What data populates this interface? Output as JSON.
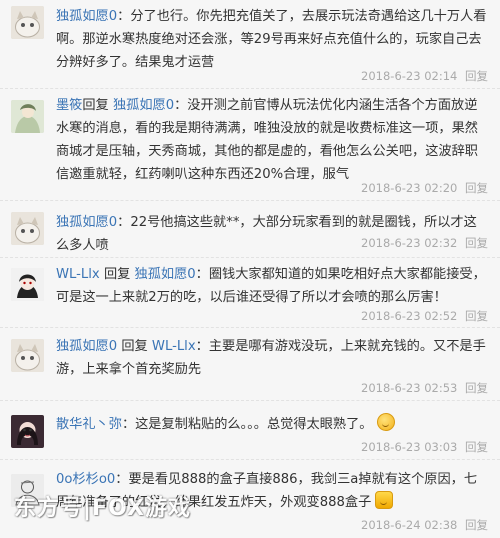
{
  "comments": [
    {
      "user": "独孤如愿0",
      "text": "：分了也行。你先把充值关了，去展示玩法奇遇给这几十万人看啊。那逆水寒热度绝对还会涨，等29号再来好点充值什么的，玩家自己去分辨好多了。结果鬼才运营",
      "time": "2018-6-23 02:14",
      "reply": "回复",
      "avatar_icon": "cat-avatar-icon"
    },
    {
      "user": "墨筱",
      "reply_word": "回复",
      "target": "独孤如愿0",
      "text": "：没开测之前官博从玩法优化内涵生活各个方面放逆水寒的消息，看的我是期待满满，唯独没放的就是收费标准这一项，果然商城才是压轴，天秀商城，其他的都是虚的，看他怎么公关吧，这波辞职信邀重就轻，红药喇叭这种东西还20%合理，服气",
      "time": "2018-6-23 02:20",
      "reply": "回复",
      "avatar_icon": "illustrated-avatar-icon"
    },
    {
      "user": "独孤如愿0",
      "text": "：22号他搞这些就**，大部分玩家看到的就是圈钱，所以才这么多人喷",
      "time": "2018-6-23 02:32",
      "reply": "回复",
      "avatar_icon": "cat-avatar-icon"
    },
    {
      "user": "WL-Llx",
      "reply_word": "回复",
      "target": "独孤如愿0",
      "text": "：圈钱大家都知道的如果吃相好点大家都能接受，可是这一上来就2万的吃，以后谁还受得了所以才会喷的那么厉害！",
      "time": "2018-6-23 02:52",
      "reply": "回复",
      "avatar_icon": "anime-avatar-icon"
    },
    {
      "user": "独孤如愿0",
      "reply_word": "回复",
      "target": "WL-Llx",
      "text": "：主要是哪有游戏没玩，上来就充钱的。又不是手游，上来拿个首充奖励先",
      "time": "2018-6-23 02:53",
      "reply": "回复",
      "avatar_icon": "cat-avatar-icon"
    },
    {
      "user": "散华礼丶弥",
      "text": "：这是复制粘贴的么。。。总觉得太眼熟了。",
      "time": "2018-6-23 03:03",
      "reply": "回复",
      "avatar_icon": "portrait-avatar-icon",
      "emoji": "smile-emoji-icon"
    },
    {
      "user": "0o杉杉o0",
      "text": "：要是看见888的盒子直接886，我剑三a掉就有这个原因，七周年准备了的红发，结果红发五炸天，外观变888盒子",
      "time": "2018-6-24 02:38",
      "reply": "回复",
      "avatar_icon": "sketch-avatar-icon",
      "emoji": "money-emoji-icon"
    }
  ],
  "watermark": "东方号|FOX游戏",
  "colors": {
    "username": "#3a74b5",
    "meta": "#aaaaaa",
    "text": "#333333"
  }
}
